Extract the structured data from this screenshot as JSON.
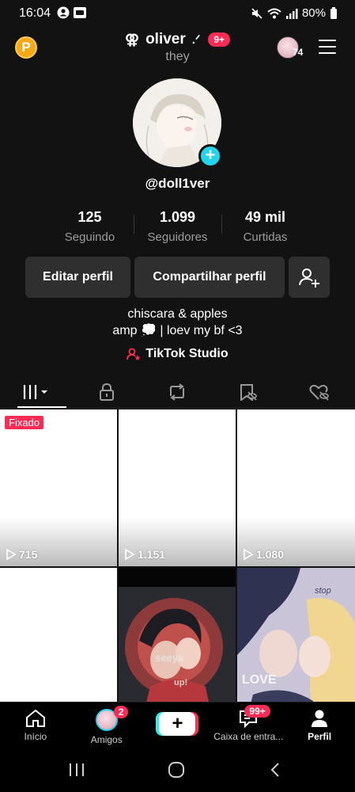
{
  "status_bar": {
    "time": "16:04",
    "battery": "80%"
  },
  "header": {
    "coin_label": "P",
    "username": "oliver",
    "name_suffix": ".ᐟ",
    "gender_symbol": "⚢",
    "notification_count": "9+",
    "pronouns": "they",
    "avatar_count": "74"
  },
  "profile": {
    "handle": "@doll1ver",
    "stats": [
      {
        "value": "125",
        "label": "Seguindo"
      },
      {
        "value": "1.099",
        "label": "Seguidores"
      },
      {
        "value": "49 mil",
        "label": "Curtidas"
      }
    ],
    "buttons": {
      "edit": "Editar perfil",
      "share": "Compartilhar perfil"
    },
    "bio_line1": "chiscara & apples",
    "bio_line2": "amp 💭 | loev my bf <3",
    "studio_label": "TikTok Studio"
  },
  "tabs": [
    "videos",
    "private",
    "reposts",
    "saved",
    "liked"
  ],
  "grid": {
    "pinned_label": "Fixado",
    "videos": [
      {
        "views": "715",
        "pinned": true
      },
      {
        "views": "1.151",
        "pinned": false
      },
      {
        "views": "1.080",
        "pinned": false
      },
      {
        "views": "",
        "pinned": false
      },
      {
        "views": "",
        "pinned": false
      },
      {
        "views": "",
        "pinned": false
      }
    ]
  },
  "bottom_nav": {
    "items": [
      {
        "label": "Início"
      },
      {
        "label": "Amigos",
        "badge": "2"
      },
      {
        "label": ""
      },
      {
        "label": "Caixa de entra...",
        "badge": "99+"
      },
      {
        "label": "Perfil"
      }
    ]
  },
  "colors": {
    "accent": "#fe2c55",
    "cyan": "#20d5ec",
    "background": "#121212",
    "button": "#2f2f2f"
  }
}
